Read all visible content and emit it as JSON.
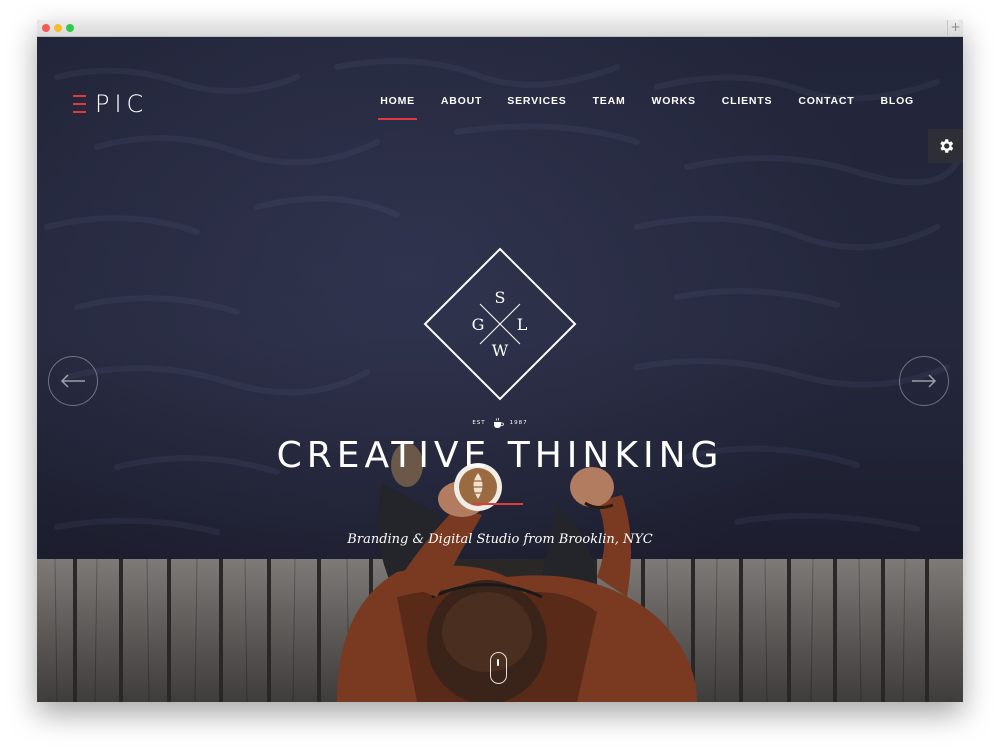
{
  "brand": {
    "logo_text": "PIC",
    "accent_color": "#e03a3e"
  },
  "nav": {
    "items": [
      {
        "label": "HOME",
        "active": true
      },
      {
        "label": "ABOUT",
        "active": false
      },
      {
        "label": "SERVICES",
        "active": false
      },
      {
        "label": "TEAM",
        "active": false
      },
      {
        "label": "WORKS",
        "active": false
      },
      {
        "label": "CLIENTS",
        "active": false
      },
      {
        "label": "CONTACT",
        "active": false
      },
      {
        "label": "BLOG",
        "active": false
      }
    ]
  },
  "settings": {
    "icon": "gear-icon"
  },
  "slider": {
    "prev_icon": "arrow-left-icon",
    "next_icon": "arrow-right-icon"
  },
  "emblem": {
    "letters": {
      "top": "S",
      "left": "G",
      "right": "L",
      "bottom": "W"
    },
    "est_left": "EST",
    "est_right": "1987",
    "est_icon": "coffee-cup-icon"
  },
  "hero": {
    "headline": "CREATIVE THINKING",
    "subline": "Branding & Digital Studio from Brooklin, NYC"
  },
  "scroll": {
    "icon": "mouse-scroll-icon"
  }
}
